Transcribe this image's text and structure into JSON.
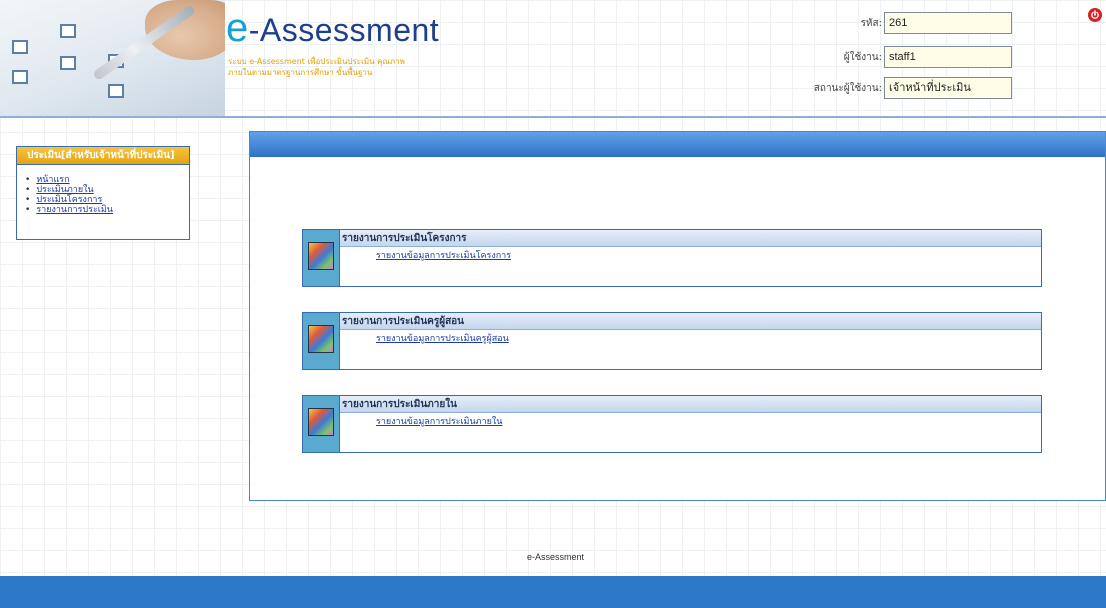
{
  "header": {
    "logo_title_e": "e",
    "logo_title_rest": "-Assessment",
    "logo_subtitle": "ระบบ e-Assessment เพื่อประเมินประเมิน คุณภาพภายในตามมาตรฐานการศึกษา ขั้นพื้นฐาน",
    "fields": [
      {
        "label": "รหัส:",
        "value": "261"
      },
      {
        "label": "ผู้ใช้งาน:",
        "value": "staff1"
      },
      {
        "label": "สถานะผู้ใช้งาน:",
        "value": "เจ้าหน้าที่ประเมิน"
      }
    ],
    "logout_icon": "power-icon"
  },
  "sidebar": {
    "title": "ประเมิน[สำหรับเจ้าหน้าที่ประเมิน]",
    "items": [
      {
        "label": "หน้าแรก"
      },
      {
        "label": "ประเมินภายใน"
      },
      {
        "label": "ประเมินโครงการ"
      },
      {
        "label": "รายงานการประเมิน"
      }
    ]
  },
  "reports": [
    {
      "title": "รายงานการประเมินโครงการ",
      "link": "รายงานข้อมูลการประเมินโครงการ"
    },
    {
      "title": "รายงานการประเมินครูผู้สอน",
      "link": "รายงานข้อมูลการประเมินครูผู้สอน"
    },
    {
      "title": "รายงานการประเมินภายใน",
      "link": "รายงานข้อมูลการประเมินภายใน"
    }
  ],
  "footer": {
    "text": "e-Assessment"
  },
  "colors": {
    "primary": "#2e78c8",
    "accent": "#e6a313",
    "link": "#1c3aa6"
  }
}
